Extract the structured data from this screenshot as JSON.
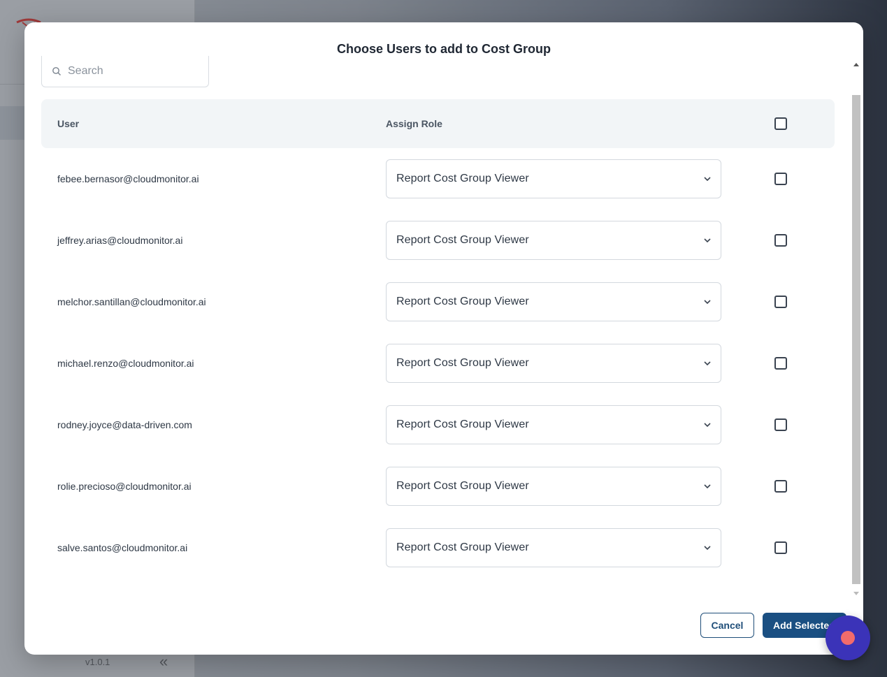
{
  "background": {
    "version": "v1.0.1",
    "collapse_glyph": "«"
  },
  "modal": {
    "title": "Choose Users to add to Cost Group",
    "search": {
      "placeholder": "Search",
      "value": ""
    },
    "table": {
      "columns": {
        "user": "User",
        "role": "Assign Role"
      },
      "rows": [
        {
          "email": "febee.bernasor@cloudmonitor.ai",
          "role": "Report Cost Group Viewer",
          "checked": false
        },
        {
          "email": "jeffrey.arias@cloudmonitor.ai",
          "role": "Report Cost Group Viewer",
          "checked": false
        },
        {
          "email": "melchor.santillan@cloudmonitor.ai",
          "role": "Report Cost Group Viewer",
          "checked": false
        },
        {
          "email": "michael.renzo@cloudmonitor.ai",
          "role": "Report Cost Group Viewer",
          "checked": false
        },
        {
          "email": "rodney.joyce@data-driven.com",
          "role": "Report Cost Group Viewer",
          "checked": false
        },
        {
          "email": "rolie.precioso@cloudmonitor.ai",
          "role": "Report Cost Group Viewer",
          "checked": false
        },
        {
          "email": "salve.santos@cloudmonitor.ai",
          "role": "Report Cost Group Viewer",
          "checked": false
        }
      ]
    },
    "buttons": {
      "cancel": "Cancel",
      "add": "Add Selected"
    }
  },
  "colors": {
    "primary": "#1a4f82",
    "fab": "#3b33b8",
    "fab_dot": "#f26b6b"
  }
}
